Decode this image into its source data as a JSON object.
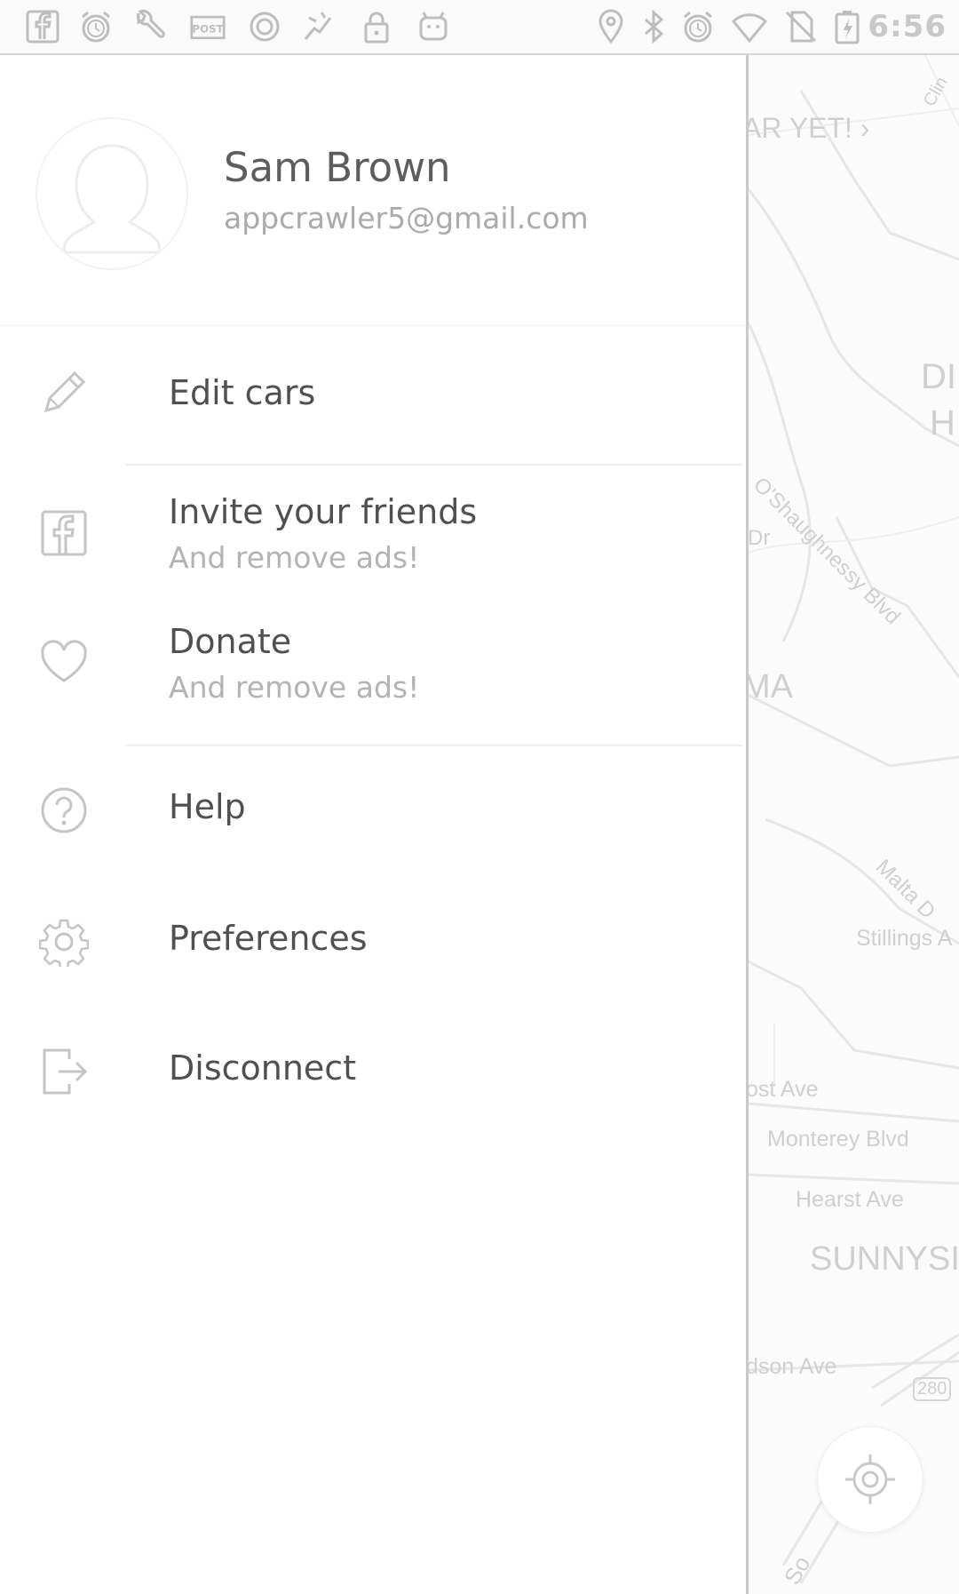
{
  "status_bar": {
    "time": "6:56",
    "left_icons": [
      "facebook-icon",
      "alarm-icon",
      "wrench-icon",
      "post-icon",
      "circle-icon",
      "sport-icon",
      "lock-icon",
      "android-icon"
    ],
    "right_icons": [
      "location-icon",
      "bluetooth-icon",
      "alarm-icon",
      "wifi-icon",
      "no-sim-icon",
      "battery-charging-icon"
    ]
  },
  "profile": {
    "name": "Sam Brown",
    "email": "appcrawler5@gmail.com"
  },
  "menu": {
    "edit_cars": {
      "label": "Edit cars",
      "icon": "pencil-icon"
    },
    "invite": {
      "label": "Invite your friends",
      "sub": "And remove ads!",
      "icon": "facebook-icon"
    },
    "donate": {
      "label": "Donate",
      "sub": "And remove ads!",
      "icon": "heart-icon"
    },
    "help": {
      "label": "Help",
      "icon": "help-icon"
    },
    "preferences": {
      "label": "Preferences",
      "icon": "gear-icon"
    },
    "disconnect": {
      "label": "Disconnect",
      "icon": "logout-icon"
    }
  },
  "map": {
    "labels": {
      "top_banner": "AR YET! ›",
      "clin": "Clin",
      "di": "DI",
      "h": "H",
      "oshaughnessy": "O'Shaughnessy Blvd",
      "dr": "Dr",
      "ma": "MA",
      "malta": "Malta D",
      "stillings": "Stillings A",
      "frost": "ost Ave",
      "monterey": "Monterey Blvd",
      "hearst": "Hearst Ave",
      "sunnyside": "SUNNYSI",
      "judson": "dson Ave",
      "route": "280",
      "so": "So"
    }
  },
  "colors": {
    "drawer_bg": "#ffffff",
    "text_primary": "#505050",
    "text_secondary": "#b3b3b3",
    "icon": "#c4c4c4"
  }
}
